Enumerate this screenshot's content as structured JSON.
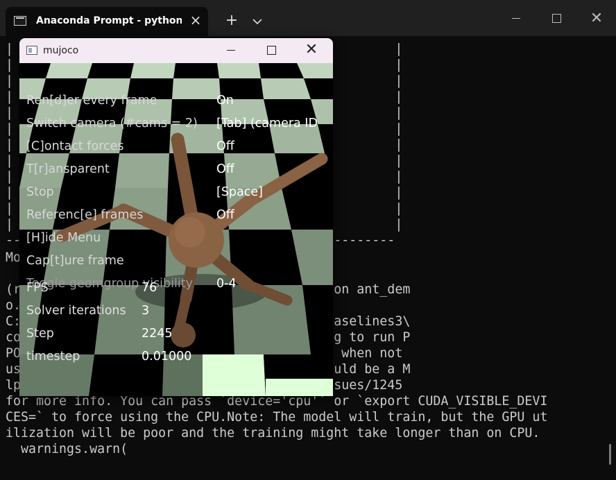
{
  "terminal": {
    "tab_title": "Anaconda Prompt - python a",
    "lines": [
      "|                                                  |",
      "|                                                  |",
      "|                                                  |",
      "|                                                  |",
      "|                                                  |",
      "|                                                  |",
      "|                                                  |",
      "|                                                  |",
      "|                                                  |",
      "|                                                  |",
      "|                                                  |",
      "|                                                  |",
      "---------------------------------------------------",
      "Mo",
      "",
      "(r                   nasium\\Ant_MuJoCo>python ant_dem",
      "o.",
      "C:                   site-packages\\stable_baselines3\\",
      "co                   Warning: You are trying to run P",
      "PO                   nded to run on the CPU when not",
      "us                   CriticPolicy which should be a M",
      "lp                   M/stable-baselines3/issues/1245",
      "for more info. You can pass `device='cpu'` or `export CUDA_VISIBLE_DEVI",
      "CES=` to force using the CPU.Note: The model will train, but the GPU ut",
      "ilization will be poor and the training might take longer than on CPU.",
      "  warnings.warn("
    ]
  },
  "mujoco": {
    "title": "mujoco",
    "menu": [
      {
        "key": "Ren[d]er every frame",
        "value": "On"
      },
      {
        "key": "Switch camera (#cams = 2)",
        "value": "[Tab] (camera ID"
      },
      {
        "key": "[C]ontact forces",
        "value": "Off"
      },
      {
        "key": "T[r]ansparent",
        "value": "Off"
      },
      {
        "key": "Stop",
        "value": "[Space]"
      },
      {
        "key": "Referenc[e] frames",
        "value": "Off"
      },
      {
        "key": "[H]ide Menu",
        "value": ""
      },
      {
        "key": "Cap[t]ure frame",
        "value": ""
      },
      {
        "key": "Toggle geomgroup visibility",
        "value": "0-4"
      }
    ],
    "info": [
      {
        "key": "FPS",
        "value": "76"
      },
      {
        "key": "Solver iterations",
        "value": "3"
      },
      {
        "key": "Step",
        "value": "2245"
      },
      {
        "key": "timestep",
        "value": "0.01000"
      }
    ]
  },
  "colors": {
    "floor_light": "#c2d6bf",
    "floor_bright": "#dfffd9",
    "ant_body": "#8a6244"
  }
}
